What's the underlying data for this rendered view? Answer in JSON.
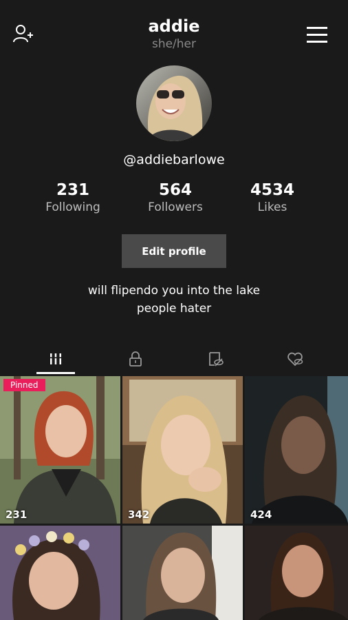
{
  "header": {
    "username": "addie",
    "pronouns": "she/her",
    "add_user_icon": "add-user-icon",
    "menu_icon": "hamburger-menu-icon"
  },
  "profile": {
    "handle": "@addiebarlowe",
    "stats": [
      {
        "value": "231",
        "label": "Following"
      },
      {
        "value": "564",
        "label": "Followers"
      },
      {
        "value": "4534",
        "label": "Likes"
      }
    ],
    "edit_label": "Edit profile",
    "bio_line1": "will flipendo you into the lake",
    "bio_line2": "people hater"
  },
  "tabs": [
    {
      "icon": "videos-grid-icon",
      "active": true
    },
    {
      "icon": "private-lock-icon",
      "active": false
    },
    {
      "icon": "hidden-eye-icon",
      "active": false
    },
    {
      "icon": "liked-heart-icon",
      "active": false
    }
  ],
  "videos": [
    {
      "views": "231",
      "badge": "Pinned"
    },
    {
      "views": "342",
      "badge": ""
    },
    {
      "views": "424",
      "badge": ""
    },
    {
      "views": "",
      "badge": ""
    },
    {
      "views": "",
      "badge": ""
    },
    {
      "views": "",
      "badge": ""
    }
  ],
  "colors": {
    "background": "#1a1a1a",
    "pinned": "#ea1e5b",
    "button": "#4a4a4a"
  }
}
